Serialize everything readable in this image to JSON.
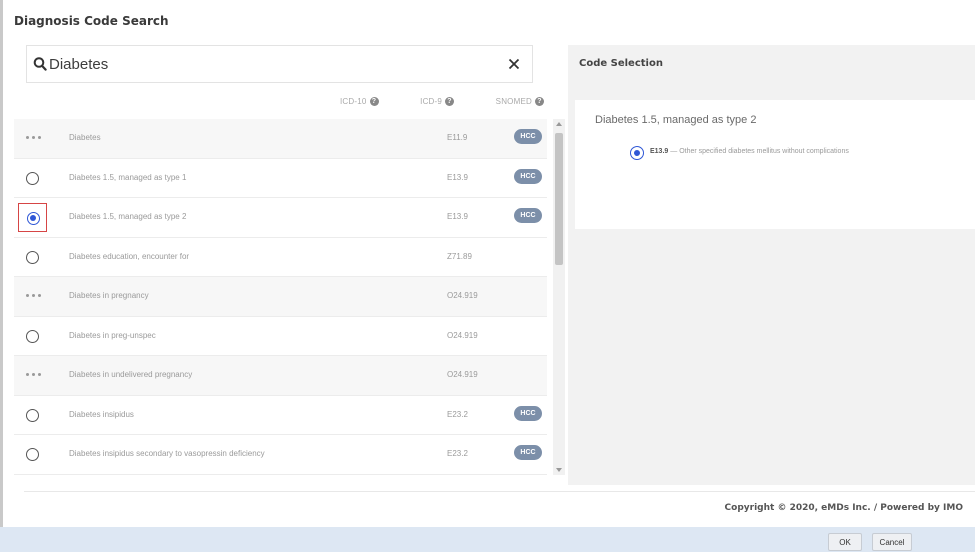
{
  "dialog": {
    "title": "Diagnosis Code Search"
  },
  "search": {
    "value": "Diabetes"
  },
  "code_systems": [
    {
      "label": "ICD-10",
      "icon": "info-icon"
    },
    {
      "label": "ICD-9",
      "icon": "info-icon"
    },
    {
      "label": "SNOMED",
      "icon": "info-icon"
    }
  ],
  "results": [
    {
      "control": "more",
      "term": "Diabetes",
      "code": "E11.9",
      "badge": "HCC"
    },
    {
      "control": "radio",
      "checked": false,
      "term": "Diabetes 1.5, managed as type 1",
      "code": "E13.9",
      "badge": "HCC"
    },
    {
      "control": "radio",
      "checked": true,
      "term": "Diabetes 1.5, managed as type 2",
      "code": "E13.9",
      "badge": "HCC"
    },
    {
      "control": "radio",
      "checked": false,
      "term": "Diabetes education, encounter for",
      "code": "Z71.89",
      "badge": ""
    },
    {
      "control": "more",
      "term": "Diabetes in pregnancy",
      "code": "O24.919",
      "badge": ""
    },
    {
      "control": "radio",
      "checked": false,
      "term": "Diabetes in preg-unspec",
      "code": "O24.919",
      "badge": ""
    },
    {
      "control": "more",
      "term": "Diabetes in undelivered pregnancy",
      "code": "O24.919",
      "badge": ""
    },
    {
      "control": "radio",
      "checked": false,
      "term": "Diabetes insipidus",
      "code": "E23.2",
      "badge": "HCC"
    },
    {
      "control": "radio",
      "checked": false,
      "term": "Diabetes insipidus secondary to vasopressin deficiency",
      "code": "E23.2",
      "badge": "HCC"
    }
  ],
  "selection": {
    "header": "Code Selection",
    "term": "Diabetes 1.5, managed as type 2",
    "code": "E13.9",
    "code_description": "— Other specified diabetes mellitus without complications"
  },
  "footer": {
    "copyright": "Copyright © 2020, eMDs Inc. / Powered by IMO",
    "ok_label": "OK",
    "cancel_label": "Cancel"
  },
  "colors": {
    "accent": "#2f57d6",
    "badge": "#7c8fa9",
    "footer_bar": "#dde7f3",
    "selection_panel": "#f2f2f2",
    "flag_outline": "#d64545"
  }
}
